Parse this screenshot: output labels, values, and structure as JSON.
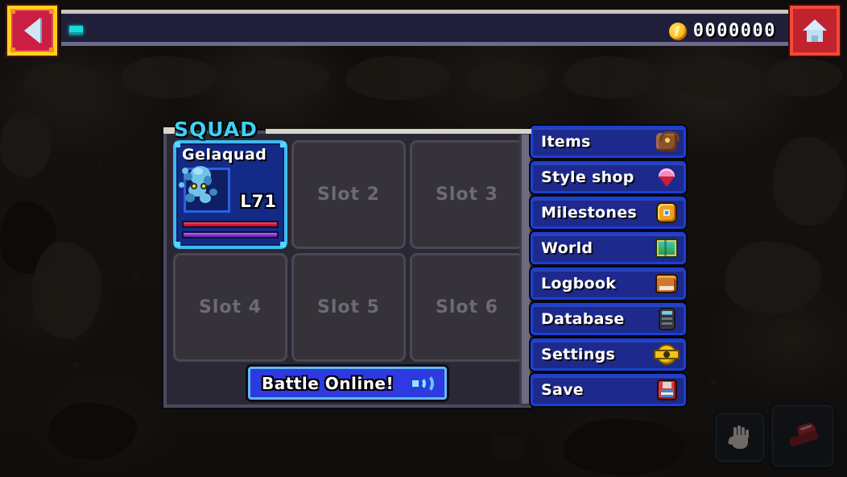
{
  "topbar": {
    "back_button": {
      "icon": "arrow-left-icon",
      "label": ""
    },
    "home_button": {
      "icon": "home-icon",
      "label": ""
    },
    "indicator": {
      "icon": "progress-chip-icon"
    },
    "currency": {
      "icon": "coin-icon",
      "amount": "0000000"
    }
  },
  "squad": {
    "title": "SQUAD",
    "slots": [
      {
        "filled": true,
        "name": "Gelaquad",
        "level": "L71",
        "sprite": "gelaquad-sprite",
        "hp_percent": 100,
        "xp_percent": 100
      },
      {
        "filled": false,
        "name": "Slot 2"
      },
      {
        "filled": false,
        "name": "Slot 3"
      },
      {
        "filled": false,
        "name": "Slot 4"
      },
      {
        "filled": false,
        "name": "Slot 5"
      },
      {
        "filled": false,
        "name": "Slot 6"
      }
    ],
    "battle_button": {
      "label": "Battle Online!",
      "icon": "broadcast-signal-icon"
    }
  },
  "menu": {
    "items": [
      {
        "label": "Items",
        "icon": "bag-icon"
      },
      {
        "label": "Style shop",
        "icon": "gem-icon"
      },
      {
        "label": "Milestones",
        "icon": "medal-icon"
      },
      {
        "label": "World",
        "icon": "map-icon"
      },
      {
        "label": "Logbook",
        "icon": "book-icon"
      },
      {
        "label": "Database",
        "icon": "server-icon"
      },
      {
        "label": "Settings",
        "icon": "gear-icon"
      },
      {
        "label": "Save",
        "icon": "floppy-disk-icon"
      }
    ]
  },
  "corner_controls": [
    {
      "icon": "hand-icon",
      "label": ""
    },
    {
      "icon": "boot-icon",
      "label": ""
    }
  ],
  "colors": {
    "accent_cyan": "#3fd0f5",
    "menu_blue": "#1d2a8c",
    "menu_border": "#1b3fd4",
    "card_blue": "#132a86",
    "card_border": "#3fb9f0",
    "hp_red": "#e2112b",
    "xp_purple": "#8e2fd6",
    "back_button_red": "#ca1f43",
    "back_button_gold": "#ffd21c",
    "home_button_red": "#c0222e",
    "panel_bg": "#2b2835",
    "slot_empty": "#353239",
    "slot_label": "#6d6a74",
    "battle_blue": "#2d3ae0"
  }
}
